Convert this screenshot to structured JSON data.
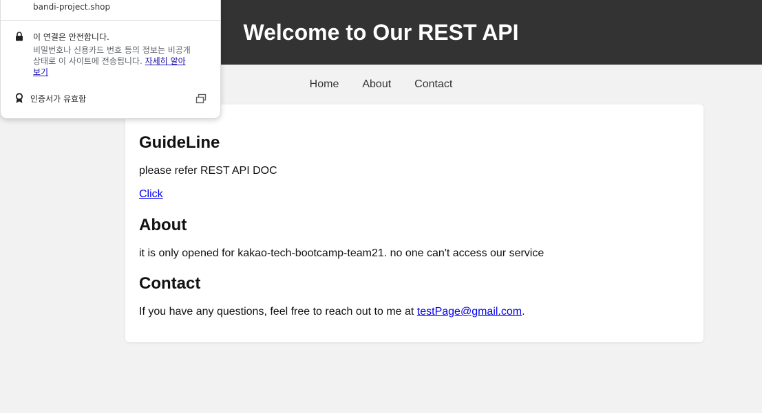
{
  "header": {
    "title": "Welcome to Our REST API"
  },
  "nav": {
    "items": [
      "Home",
      "About",
      "Contact"
    ]
  },
  "sections": {
    "guideline": {
      "heading": "GuideLine",
      "text": "please refer REST API DOC",
      "link": "Click"
    },
    "about": {
      "heading": "About",
      "text": "it is only opened for kakao-tech-bootcamp-team21. no one can't access our service"
    },
    "contact": {
      "heading": "Contact",
      "text_before": "If you have any questions, feel free to reach out to me at ",
      "email": "testPage@gmail.com",
      "text_after": "."
    }
  },
  "site_info_popup": {
    "host": "bandi-project.shop",
    "secure_title": "이 연결은 안전합니다.",
    "secure_line1": "비밀번호나 신용카드 번호 등의 정보는 비공개",
    "secure_line2": "상태로 이 사이트에 전송됩니다. ",
    "learn_more": "자세히 알아",
    "learn_more_cont": "보기",
    "certificate_label": "인증서가 유효함",
    "icons": [
      "lock-icon",
      "certificate-badge-icon",
      "open-external-icon"
    ]
  },
  "colors": {
    "header_bg": "#333333",
    "page_bg": "#f2f2f2",
    "card_bg": "#ffffff",
    "link": "#0000ee"
  }
}
